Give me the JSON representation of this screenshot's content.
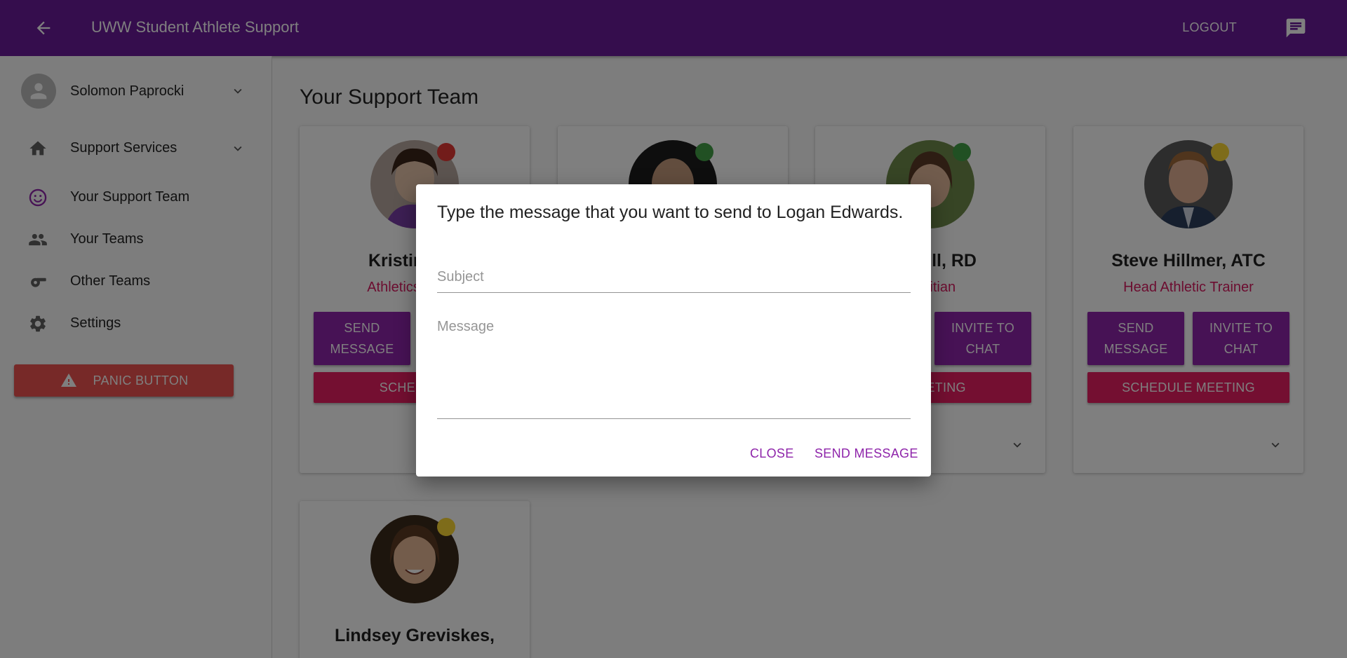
{
  "appbar": {
    "title": "UWW Student Athlete Support",
    "logout_label": "LOGOUT",
    "color": "#6a1b9a"
  },
  "sidebar": {
    "user_name": "Solomon Paprocki",
    "items": [
      {
        "label": "Support Services",
        "icon": "home-icon"
      },
      {
        "label": "Your Support Team",
        "icon": "smiley-icon"
      },
      {
        "label": "Your Teams",
        "icon": "people-icon"
      },
      {
        "label": "Other Teams",
        "icon": "whistle-icon"
      },
      {
        "label": "Settings",
        "icon": "gear-icon"
      }
    ],
    "panic_label": "PANIC BUTTON"
  },
  "main": {
    "title": "Your Support Team",
    "cards": [
      {
        "name": "Kristina Na",
        "role": "Athletics Depar",
        "status_color": "#e53935",
        "send_label": "SEND MESSAGE",
        "schedule_label": "SCHEDULE"
      },
      {
        "name": "",
        "role": "",
        "status_color": "#43a047"
      },
      {
        "name": "omdoll, RD",
        "role": "Dietitian",
        "status_color": "#43a047",
        "invite_label": "INVITE TO CHAT",
        "schedule_label": "E MEETING"
      },
      {
        "name": "Steve Hillmer, ATC",
        "role": "Head Athletic Trainer",
        "status_color": "#fdd835",
        "send_label": "SEND MESSAGE",
        "invite_label": "INVITE TO CHAT",
        "schedule_label": "SCHEDULE MEETING"
      },
      {
        "name": "Lindsey Greviskes,",
        "role": "",
        "status_color": "#fdd835"
      }
    ]
  },
  "dialog": {
    "title": "Type the message that you want to send to Logan Edwards.",
    "subject_placeholder": "Subject",
    "message_placeholder": "Message",
    "close_label": "CLOSE",
    "send_label": "SEND MESSAGE"
  }
}
